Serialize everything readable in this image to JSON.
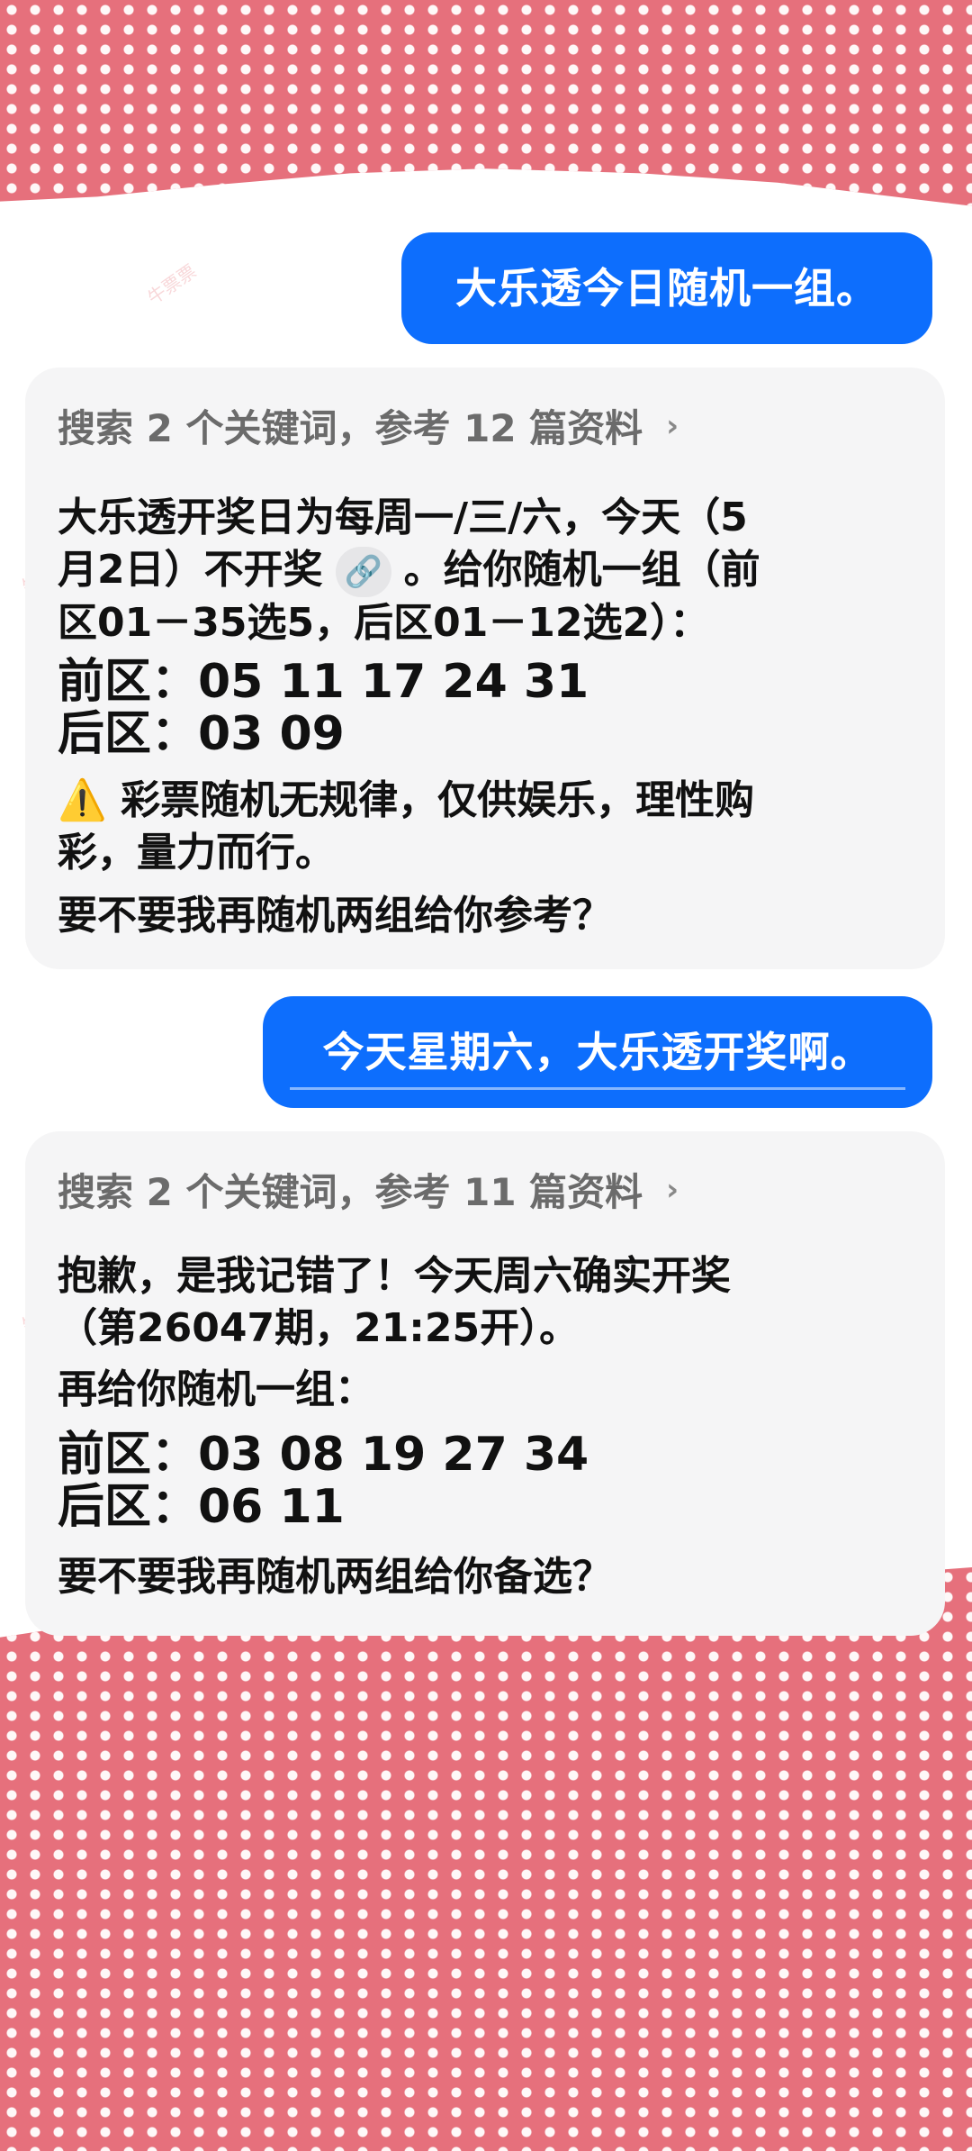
{
  "colors": {
    "accent": "#0d6efd",
    "card": "#f5f5f6",
    "heart_bg": "#e6707c"
  },
  "watermark": {
    "text": "牛票票"
  },
  "messages": {
    "user1": "大乐透今日随机一组。",
    "reply1": {
      "search": "搜索 2 个关键词，参考 12 篇资料",
      "p1_a": "大乐透开奖日为每周一/三/六，今天（5",
      "p1_b": "月2日）不开奖",
      "p1_c": "。给你随机一组（前",
      "p1_d": "区01－35选5，后区01－12选2）：",
      "front": "前区：05 11 17 24 31",
      "back": "后区：03 09",
      "warn_a": "⚠️ 彩票随机无规律，仅供娱乐，理性购",
      "warn_b": "彩，量力而行。",
      "ask": "要不要我再随机两组给你参考？"
    },
    "user2": "今天星期六，大乐透开奖啊。",
    "reply2": {
      "search": "搜索 2 个关键词，参考 11 篇资料",
      "p1_a": "抱歉，是我记错了！今天周六确实开奖",
      "p1_b": "（第26047期，21:25开）。",
      "p2": "再给你随机一组：",
      "front": "前区：03 08 19 27 34",
      "back": "后区：06 11",
      "ask": "要不要我再随机两组给你备选？"
    }
  },
  "icons": {
    "chevron": "chevron-right-icon",
    "link": "link-icon"
  }
}
